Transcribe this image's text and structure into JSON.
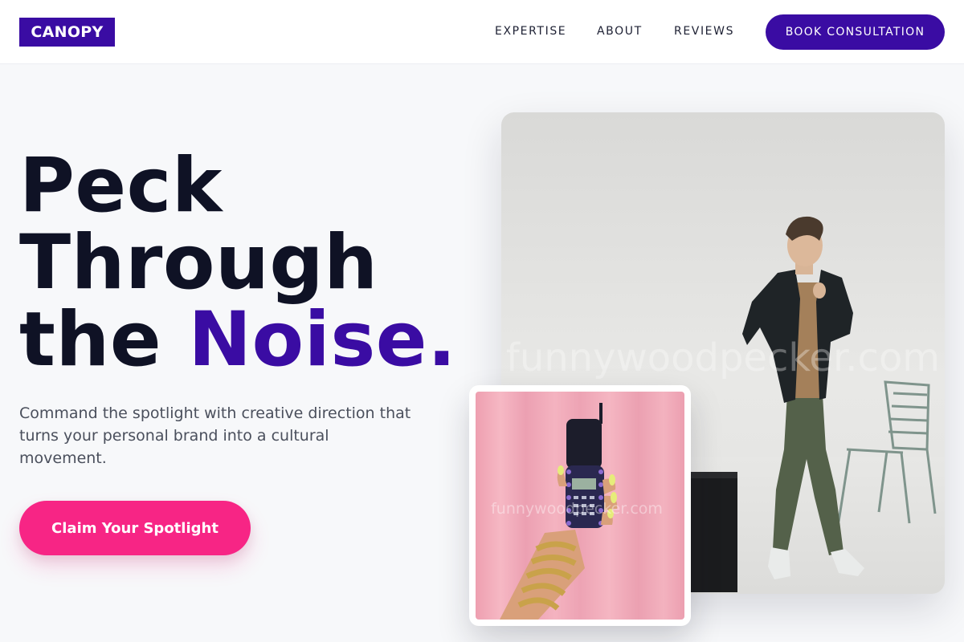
{
  "brand": {
    "logo_text": "CANOPY"
  },
  "nav": {
    "links": [
      "EXPERTISE",
      "ABOUT",
      "REVIEWS"
    ],
    "cta_label": "BOOK CONSULTATION"
  },
  "hero": {
    "headline_line1": "Peck",
    "headline_line2": "Through",
    "headline_line3_start": "the ",
    "headline_line3_accent": "Noise.",
    "subtext": "Command the spotlight with creative direction that turns your personal brand into a cultural movement.",
    "cta_label": "Claim Your Spotlight"
  },
  "images": {
    "main_photo_watermark": "funnywoodpecker.com",
    "small_photo_watermark": "funnywoodpecker.com"
  },
  "colors": {
    "brand_purple": "#3a0ca3",
    "accent_pink": "#f72585",
    "text_dark": "#0f1225",
    "text_muted": "#4a4f5c",
    "page_bg": "#f7f8fa"
  }
}
